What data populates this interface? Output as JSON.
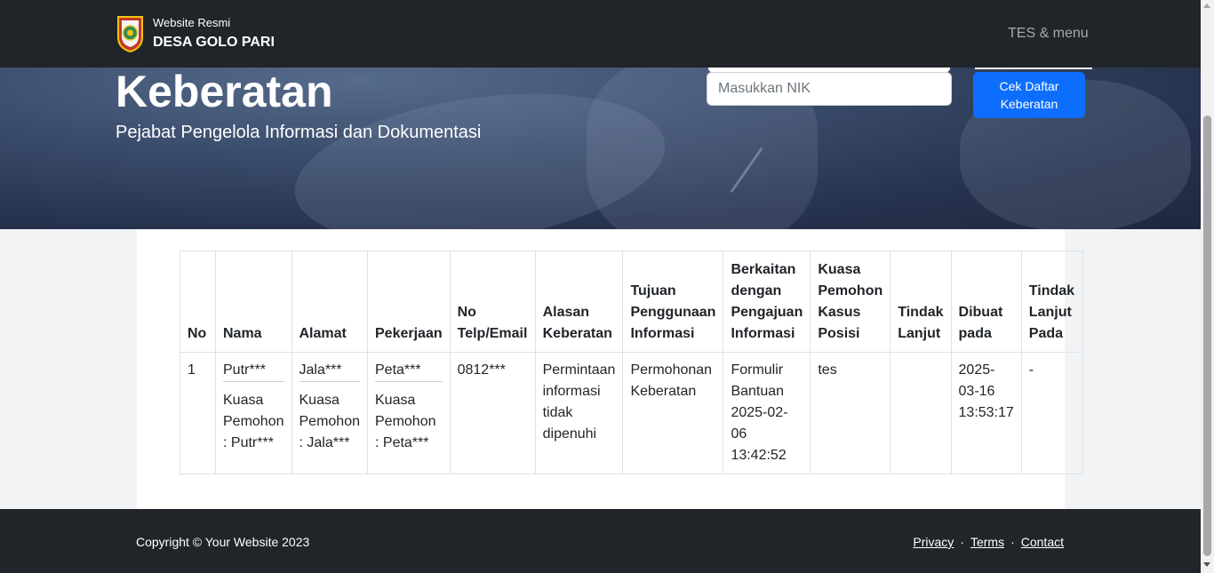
{
  "navbar": {
    "brand_small": "Website Resmi",
    "brand_big": "DESA GOLO PARI",
    "menu_label": "TES & menu"
  },
  "hero": {
    "title": "Keberatan",
    "subtitle": "Pejabat Pengelola Informasi dan Dokumentasi",
    "nik_placeholder": "Masukkan NIK",
    "check_button": "Cek Daftar Keberatan"
  },
  "table": {
    "headers": [
      "No",
      "Nama",
      "Alamat",
      "Pekerjaan",
      "No Telp/Email",
      "Alasan Keberatan",
      "Tujuan Penggunaan Informasi",
      "Berkaitan dengan Pengajuan Informasi",
      "Kuasa Pemohon Kasus Posisi",
      "Tindak Lanjut",
      "Dibuat pada",
      "Tindak Lanjut Pada"
    ],
    "rows": [
      {
        "no": "1",
        "nama": "Putr***",
        "nama_kuasa": "Kuasa Pemohon : Putr***",
        "alamat": "Jala***",
        "alamat_kuasa": "Kuasa Pemohon : Jala***",
        "pekerjaan": "Peta***",
        "pekerjaan_kuasa": "Kuasa Pemohon : Peta***",
        "telp": "0812***",
        "alasan": "Permintaan informasi tidak dipenuhi",
        "tujuan": "Permohonan Keberatan",
        "berkaitan": "Formulir Bantuan 2025-02-06 13:42:52",
        "kuasa_kasus": "tes",
        "tindak_lanjut": "",
        "dibuat": "2025-03-16 13:53:17",
        "tindak_lanjut_pada": "-"
      }
    ]
  },
  "footer": {
    "copyright": "Copyright © Your Website 2023",
    "links": [
      "Privacy",
      "Terms",
      "Contact"
    ],
    "separator": "·"
  },
  "icons": {
    "logo": "regency-emblem-icon"
  },
  "colors": {
    "navbar_bg": "#212529",
    "button_primary": "#0d6efd"
  }
}
